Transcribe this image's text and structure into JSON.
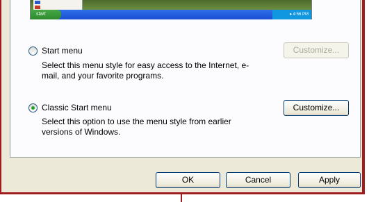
{
  "preview": {
    "start_label": "start",
    "tray_text": "● 4:56 PM"
  },
  "options": {
    "start_menu": {
      "label": "Start menu",
      "description": "Select this menu style for easy access to the Internet, e-mail, and your favorite programs.",
      "selected": false,
      "customize_label": "Customize...",
      "customize_enabled": false
    },
    "classic_start_menu": {
      "label": "Classic Start menu",
      "description": "Select this option to use the menu style from earlier versions of Windows.",
      "selected": true,
      "customize_label": "Customize...",
      "customize_enabled": true
    }
  },
  "footer": {
    "ok_label": "OK",
    "cancel_label": "Cancel",
    "apply_label": "Apply"
  },
  "colors": {
    "dialog_bg": "#ece9d8",
    "panel_bg": "#fcfcfe",
    "radio_dot": "#21a121",
    "annotation_frame": "#a11d1d"
  }
}
